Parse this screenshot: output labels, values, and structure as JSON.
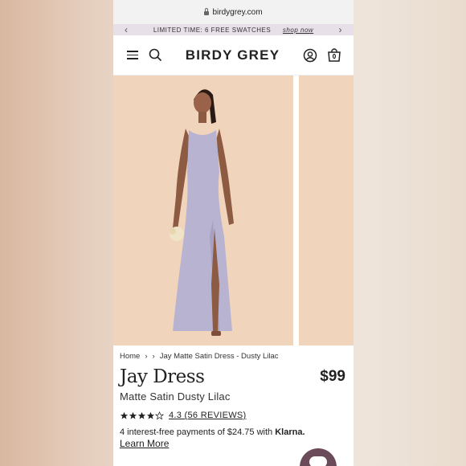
{
  "browser": {
    "url": "birdygrey.com"
  },
  "promo": {
    "text": "LIMITED TIME: 6 FREE SWATCHES",
    "link": "shop now"
  },
  "header": {
    "logo": "BIRDY GREY",
    "cart_count": "0"
  },
  "breadcrumb": {
    "home": "Home",
    "current": "Jay Matte Satin Dress - Dusty Lilac"
  },
  "product": {
    "title": "Jay Dress",
    "price": "$99",
    "subtitle": "Matte Satin Dusty Lilac",
    "rating": 4.3,
    "reviews_text": "4.3 (56 REVIEWS)",
    "installments": "4 interest-free payments of $24.75 with",
    "klarna": "Klarna.",
    "learn_more": "Learn More"
  },
  "colors": {
    "dress": "#b9b3d2",
    "backdrop": "#f0d4bc",
    "chat": "#6b4a5a"
  },
  "icons": [
    "lock-icon",
    "menu-icon",
    "search-icon",
    "account-icon",
    "cart-icon",
    "star-icon",
    "chevron-right-icon",
    "chat-icon"
  ]
}
